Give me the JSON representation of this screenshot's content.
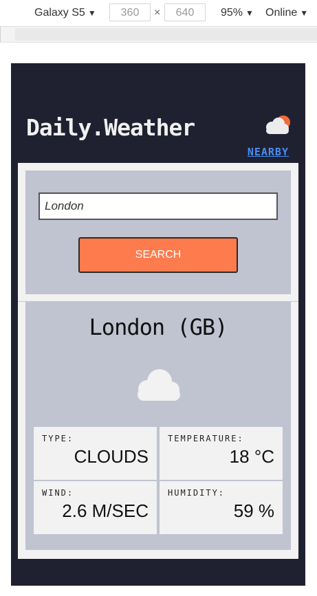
{
  "devtools": {
    "device": "Galaxy S5",
    "width": "360",
    "height": "640",
    "times": "×",
    "zoom": "95%",
    "network": "Online",
    "caret": "▼"
  },
  "app": {
    "brand": "Daily.Weather",
    "nearby_link": "NEARBY"
  },
  "search": {
    "input_value": "London",
    "button_label": "SEARCH"
  },
  "result": {
    "city": "London (GB)",
    "icon": "cloud-icon",
    "details": [
      {
        "label": "TYPE:",
        "value": "CLOUDS"
      },
      {
        "label": "TEMPERATURE:",
        "value": "18 °C"
      },
      {
        "label": "WIND:",
        "value": "2.6 M/SEC"
      },
      {
        "label": "HUMIDITY:",
        "value": "59 %"
      }
    ]
  },
  "colors": {
    "background": "#1f2130",
    "panel": "#c0c3d0",
    "accent": "#fe7b4d",
    "link": "#4a8df5"
  }
}
